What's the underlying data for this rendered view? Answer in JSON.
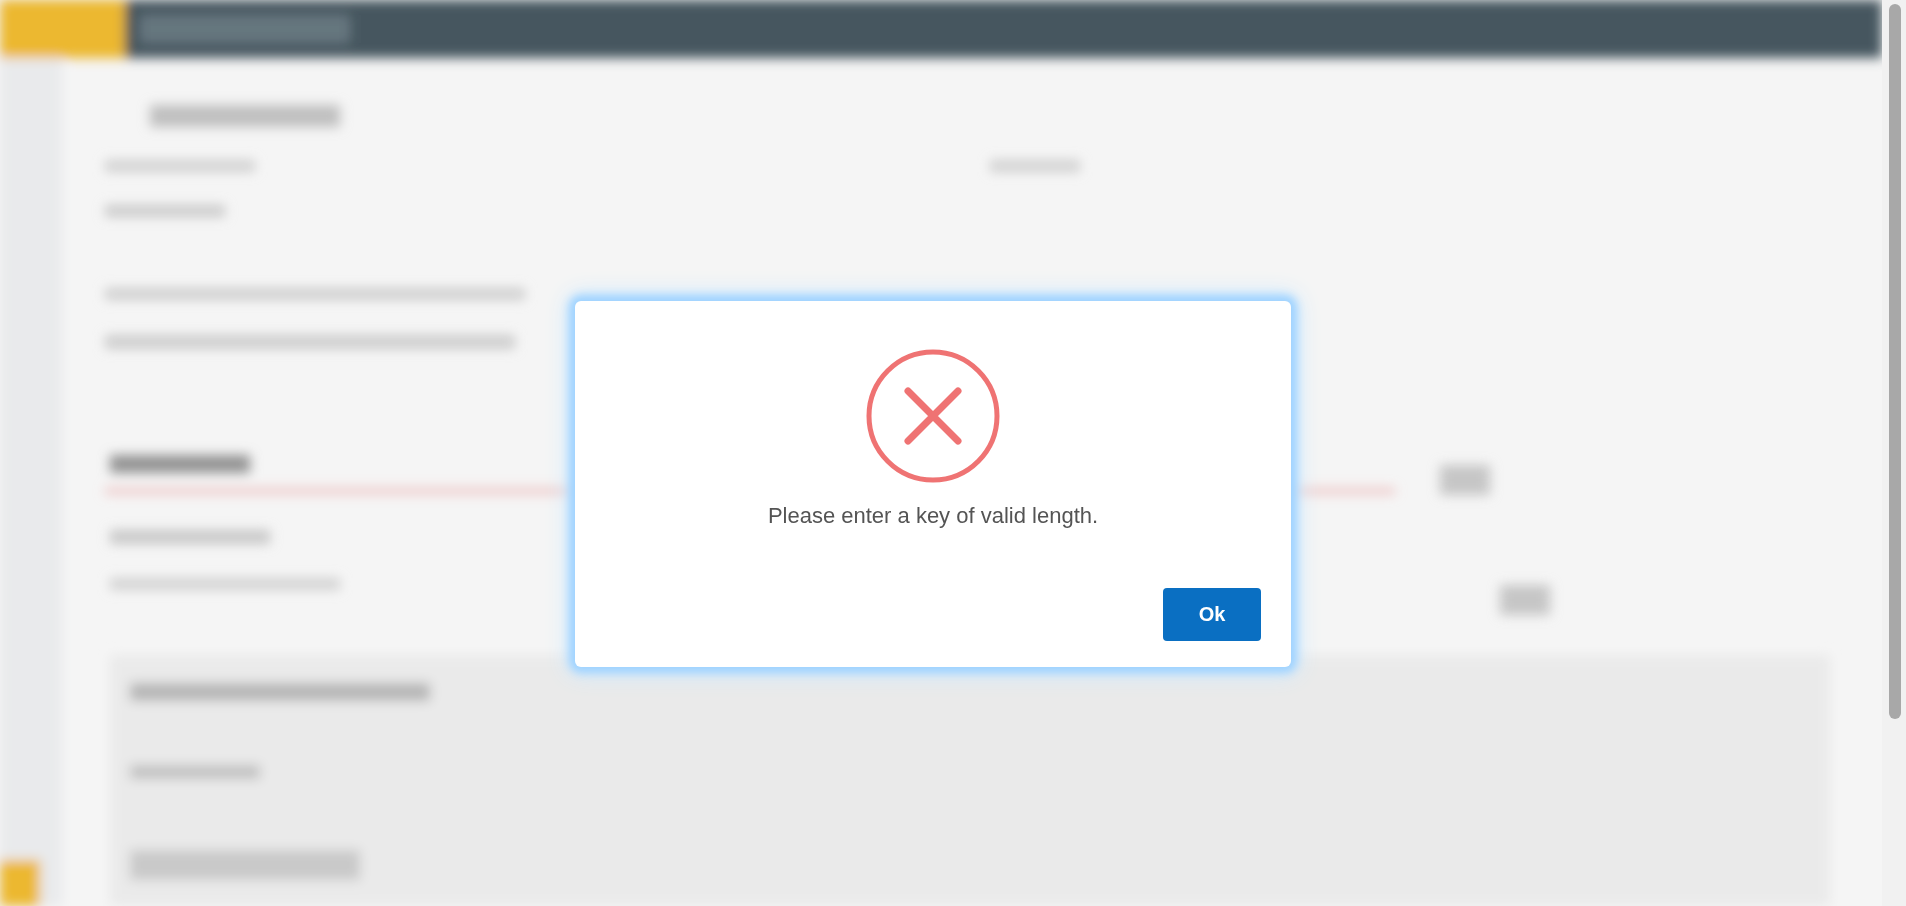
{
  "dialog": {
    "kind": "error",
    "message": "Please enter a key of valid length.",
    "buttons": [
      {
        "label": "Ok"
      }
    ]
  }
}
